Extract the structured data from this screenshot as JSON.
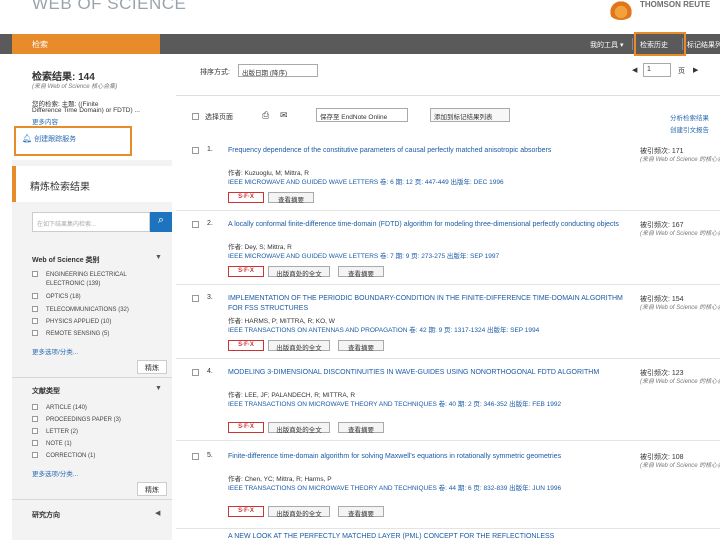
{
  "header": {
    "brand": "WEB OF SCIENCE",
    "tr_brand": "THOMSON REUTE"
  },
  "nav": {
    "search_tab": "检索",
    "my_tools": "我的工具 ▾",
    "search_history": "检索历史",
    "marked_list": "标记结果列"
  },
  "left": {
    "results_title": "检索结果: 144",
    "results_sub": "(来自 Web of Science 核心合集)",
    "query_line1": "您的检索: 主题: ((Finite",
    "query_line2": "Difference Time Domain) or FDTD) ...",
    "query_line3": "更多内容",
    "alert": "创建跟踪服务",
    "refine_title": "精炼检索结果",
    "refine_placeholder": "在如下结果集内检索...",
    "refine_btn_icon": "search-icon",
    "facets": [
      {
        "title": "Web of Science 类别",
        "items": [
          "ENGINEERING ELECTRICAL",
          "ELECTRONIC (139)",
          "OPTICS (18)",
          "TELECOMMUNICATIONS (32)",
          "PHYSICS APPLIED (10)",
          "REMOTE SENSING (5)"
        ],
        "more": "更多选项/分类...",
        "refine": "精炼"
      },
      {
        "title": "文献类型",
        "items": [
          "ARTICLE (140)",
          "PROCEEDINGS PAPER (3)",
          "LETTER (2)",
          "NOTE (1)",
          "CORRECTION (1)"
        ],
        "more": "更多选项/分类...",
        "refine": "精炼"
      },
      {
        "title": "研究方向",
        "items": [],
        "more": "",
        "refine": ""
      }
    ]
  },
  "toolbar": {
    "sort_label": "排序方式:",
    "sort_value": "出版日期 (降序)",
    "page_value": "1",
    "page_suffix": "页",
    "select_page": "选择页面",
    "export_select": "保存至 EndNote Online",
    "add_marked": "添加到标记结果列表",
    "analyze": "分析检索结果",
    "citation_report": "创建引文报告"
  },
  "records": [
    {
      "num": "1.",
      "title": "Frequency dependence of the constitutive parameters of causal perfectly matched anisotropic absorbers",
      "authors": "作者: Kuzuoglu, M; Mittra, R",
      "source": "IEEE MICROWAVE AND GUIDED WAVE LETTERS  卷: 6  期: 12  页: 447-449  出版年: DEC 1996",
      "buttons": [
        "S·F·X",
        "查看摘要"
      ],
      "cites": "被引频次: 171",
      "cites_sub": "(来自 Web of Science 的核心合集)"
    },
    {
      "num": "2.",
      "title": "A locally conformal finite-difference time-domain (FDTD) algorithm for modeling three-dimensional perfectly conducting objects",
      "authors": "作者: Dey, S; Mittra, R",
      "source": "IEEE MICROWAVE AND GUIDED WAVE LETTERS  卷: 7  期: 9  页: 273-275  出版年: SEP 1997",
      "buttons": [
        "S·F·X",
        "出版商处的全文",
        "查看摘要"
      ],
      "cites": "被引频次: 167",
      "cites_sub": "(来自 Web of Science 的核心合集)"
    },
    {
      "num": "3.",
      "title": "IMPLEMENTATION OF THE PERIODIC BOUNDARY-CONDITION IN THE FINITE-DIFFERENCE TIME-DOMAIN ALGORITHM FOR FSS STRUCTURES",
      "authors": "作者: HARMS, P; MITTRA, R; KO, W",
      "source": "IEEE TRANSACTIONS ON ANTENNAS AND PROPAGATION  卷: 42  期: 9  页: 1317-1324  出版年: SEP 1994",
      "buttons": [
        "S·F·X",
        "出版商处的全文",
        "查看摘要"
      ],
      "cites": "被引频次: 154",
      "cites_sub": "(来自 Web of Science 的核心合集)"
    },
    {
      "num": "4.",
      "title": "MODELING 3-DIMENSIONAL DISCONTINUITIES IN WAVE-GUIDES USING NONORTHOGONAL FDTD ALGORITHM",
      "authors": "作者: LEE, JF; PALANDECH, R; MITTRA, R",
      "source": "IEEE TRANSACTIONS ON MICROWAVE THEORY AND TECHNIQUES  卷: 40  期: 2  页: 346-352  出版年: FEB 1992",
      "buttons": [
        "S·F·X",
        "出版商处的全文",
        "查看摘要"
      ],
      "cites": "被引频次: 123",
      "cites_sub": "(来自 Web of Science 的核心合集)"
    },
    {
      "num": "5.",
      "title": "Finite-difference time-domain algorithm for solving Maxwell's equations in rotationally symmetric geometries",
      "authors": "作者: Chen, YC; Mittra, R; Harms, P",
      "source": "IEEE TRANSACTIONS ON MICROWAVE THEORY AND TECHNIQUES  卷: 44  期: 6  页: 832-839  出版年: JUN 1996",
      "buttons": [
        "S·F·X",
        "出版商处的全文",
        "查看摘要"
      ],
      "cites": "被引频次: 108",
      "cites_sub": "(来自 Web of Science 的核心合集)"
    }
  ],
  "record6_title": "A NEW LOOK AT THE PERFECTLY MATCHED LAYER (PML) CONCEPT FOR THE REFLECTIONLESS",
  "colors": {
    "accent": "#e88b2b",
    "nav": "#5a5a5a",
    "link": "#1a5aa6",
    "highlight": "#fff36e"
  }
}
